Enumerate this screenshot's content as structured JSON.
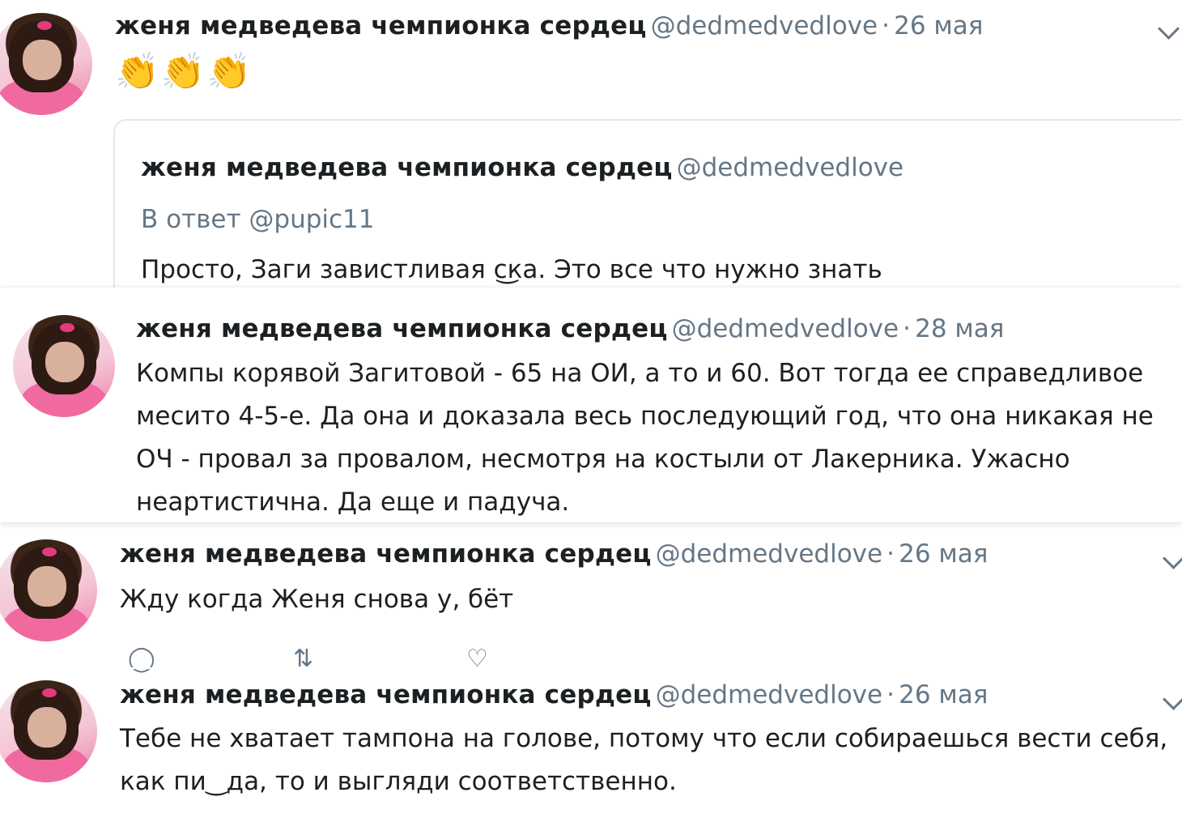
{
  "tweets": [
    {
      "name": "женя медведева чемпионка сердец",
      "handle": "@dedmedvedlove",
      "separator": "·",
      "date": "26 мая",
      "text": "👏👏👏",
      "quoted": {
        "name": "женя медведева чемпионка сердец",
        "handle": "@dedmedvedlove",
        "reply_to": "В ответ @pupic11",
        "text": "Просто, Заги завистливая с͜ка. Это все что нужно знать"
      }
    },
    {
      "name": "женя медведева чемпионка сердец",
      "handle": "@dedmedvedlove",
      "separator": "·",
      "date": "28 мая",
      "lines": [
        "Компы корявой Загитовой - 65 на ОИ, а то и 60. Вот тогда ее справедливое",
        "месито 4-5-е. Да она и доказала весь последующий год, что она никакая не",
        "ОЧ - провал за провалом, несмотря на костыли от Лакерника. Ужасно",
        "неартистична. Да еще и падуча."
      ]
    },
    {
      "name": "женя медведева чемпионка сердец",
      "handle": "@dedmedvedlove",
      "separator": "·",
      "date": "26 мая",
      "text": "Жду когда Женя снова у‚ бёт",
      "actions": [
        "reply-icon",
        "retweet-icon",
        "like-icon"
      ]
    },
    {
      "name": "женя медведева чемпионка сердец",
      "handle": "@dedmedvedlove",
      "separator": "·",
      "date": "26 мая",
      "lines": [
        "Тебе не хватает тампона на голове, потому что если собираешься вести себя,",
        "как пи‿да, то и выгляди соответственно."
      ]
    }
  ],
  "colors": {
    "text": "#1c2022",
    "secondary": "#657786",
    "border": "#e1e8ed"
  }
}
